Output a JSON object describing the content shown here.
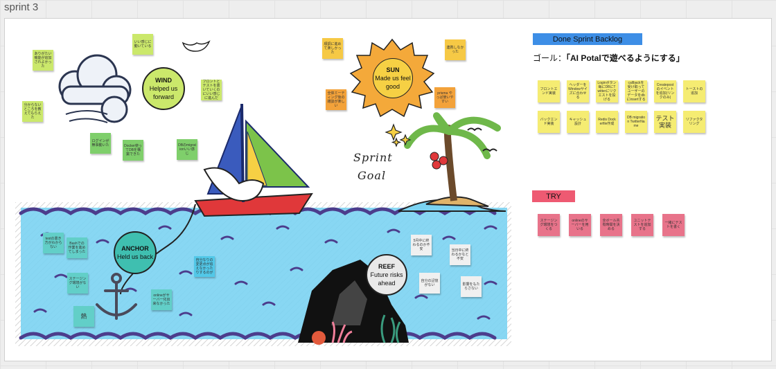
{
  "board": {
    "title": "sprint 3"
  },
  "sun": {
    "title": "SUN",
    "body": "Made us feel good"
  },
  "wind": {
    "title": "WIND",
    "body": "Helped us forward"
  },
  "anchor": {
    "title": "ANCHOR",
    "body": "Held us back"
  },
  "reef": {
    "title": "REEF",
    "body": "Future risks ahead"
  },
  "sprint_goal": {
    "line1": "Sprint",
    "line2": "Goal"
  },
  "backlog": {
    "title": "Done Sprint Backlog",
    "goal_prefix": "ゴール：",
    "goal_text": "「AI Potalで遊べるようにする」",
    "row1": [
      "フロントエンド実装",
      "ヘッダーをWindowサイズに合わせる",
      "Loginボタン毎にDBにTwitterにリクエストを投げる",
      "callbackを受け取ってユーザーのデータをdbにinsertする",
      "Createpostのイベントを追加(リンクのみ)",
      "トーストの追加"
    ],
    "row2": [
      "バックエンド実装",
      "キャッシュ設計",
      "Redis Dockerfile作成",
      "DB migration TwitterName",
      "テスト実装",
      "リファクタリング"
    ]
  },
  "try": {
    "title": "TRY",
    "notes": [
      "ステージング環境をつくる",
      "onlineのサーバーを用いる",
      "全ボール共有時間を決める",
      "ユニットテストを追加する",
      "一緒にテストを書く"
    ]
  },
  "wind_notes": [
    {
      "text": "ありがたい機能が追加されよかった",
      "color": "#cbe86b"
    },
    {
      "text": "いい感じに動いている",
      "color": "#cbe86b"
    },
    {
      "text": "分からないところを教えてもらえた",
      "color": "#cbe86b"
    },
    {
      "text": "フロントとテストを書いていくのにいい感じに進んだ",
      "color": "#cbe86b"
    },
    {
      "text": "ログインが無事動いた",
      "color": "#7fcf6b"
    },
    {
      "text": "Docker使ってDBを構築できた",
      "color": "#7fcf6b"
    },
    {
      "text": "DBのmigrationいい感じ",
      "color": "#7fcf6b"
    }
  ],
  "sun_notes": [
    {
      "text": "順調に進めて楽しかった",
      "color": "#f6c945"
    },
    {
      "text": "連携しなかった",
      "color": "#f6c945"
    },
    {
      "text": "全体ミーティング後の雑談が楽しい",
      "color": "#f3a23a"
    },
    {
      "text": "prisma やっぱ使いやすい",
      "color": "#f3a23a"
    }
  ],
  "anchor_notes": [
    {
      "text": "testの書き方がわからない",
      "color": "#62cfc8"
    },
    {
      "text": "Bashでの作業を進めてしまった",
      "color": "#62cfc8"
    },
    {
      "text": "ステージング環境がない",
      "color": "#62cfc8"
    },
    {
      "text": "熱",
      "color": "#62cfc8"
    },
    {
      "text": "onlineがサーバー化出来なかった",
      "color": "#62cfc8"
    },
    {
      "text": "自分なりの変更点が追えなかったりするのが",
      "color": "#52c8e8"
    }
  ],
  "reef_notes": [
    {
      "text": "5月中に終わるのか不安",
      "color": "#f0f0f0"
    },
    {
      "text": "当日中に終わるかなと不安",
      "color": "#f0f0f0"
    },
    {
      "text": "自分の記憶がない",
      "color": "#f0f0f0"
    },
    {
      "text": "影響をもたらさない",
      "color": "#f0f0f0"
    }
  ],
  "colors": {
    "backlog_tag": "#3d8ee6",
    "try_tag": "#ee5a72",
    "backlog_note": "#f5ec72",
    "try_note": "#e8738a",
    "sea": "#7bd3f2",
    "wave": "#4c3d8c",
    "sail_blue": "#1b2a6b"
  }
}
